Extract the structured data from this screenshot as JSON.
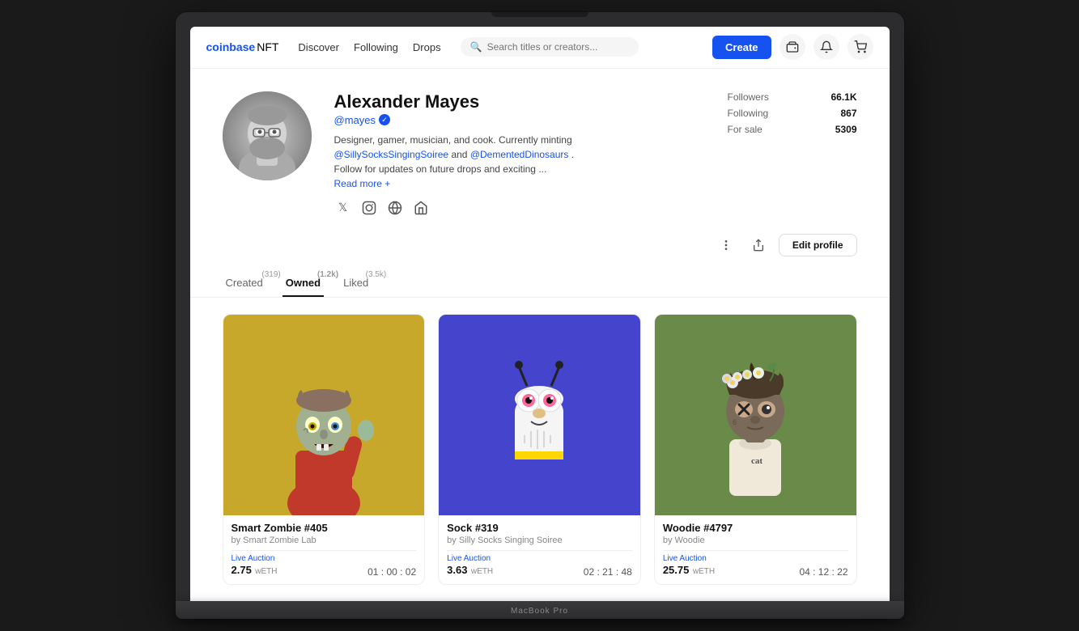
{
  "laptop": {
    "label": "MacBook Pro"
  },
  "navbar": {
    "brand_coinbase": "coinbase",
    "brand_nft": "NFT",
    "discover": "Discover",
    "following": "Following",
    "drops": "Drops",
    "search_placeholder": "Search titles or creators...",
    "create_label": "Create"
  },
  "profile": {
    "name": "Alexander Mayes",
    "handle": "@mayes",
    "bio_line1": "Designer, gamer, musician, and cook. Currently minting",
    "bio_link1": "@SillySocksSingingSoiree",
    "bio_and": "and",
    "bio_link2": "@DementedDinosaurs",
    "bio_line2": ".",
    "bio_line3": "Follow for updates on future drops and exciting ...",
    "read_more": "Read more +",
    "stats": {
      "followers_label": "Followers",
      "followers_value": "66.1K",
      "following_label": "Following",
      "following_value": "867",
      "for_sale_label": "For sale",
      "for_sale_value": "5309"
    },
    "edit_profile_label": "Edit profile"
  },
  "tabs": [
    {
      "label": "Created",
      "count": "(319)",
      "active": false
    },
    {
      "label": "Owned",
      "count": "(1.2k)",
      "active": true
    },
    {
      "label": "Liked",
      "count": "(3.5k)",
      "active": false
    }
  ],
  "nfts": [
    {
      "title": "Smart Zombie #405",
      "creator": "by Smart Zombie Lab",
      "auction_label": "Live Auction",
      "price": "2.75",
      "price_unit": "wETH",
      "timer": "01 : 00 : 02",
      "bg": "zombie"
    },
    {
      "title": "Sock #319",
      "creator": "by Silly Socks Singing Soiree",
      "auction_label": "Live Auction",
      "price": "3.63",
      "price_unit": "wETH",
      "timer": "02 : 21 : 48",
      "bg": "sock"
    },
    {
      "title": "Woodie #4797",
      "creator": "by Woodie",
      "auction_label": "Live Auction",
      "price": "25.75",
      "price_unit": "wETH",
      "timer": "04 : 12 : 22",
      "bg": "woodie"
    }
  ]
}
